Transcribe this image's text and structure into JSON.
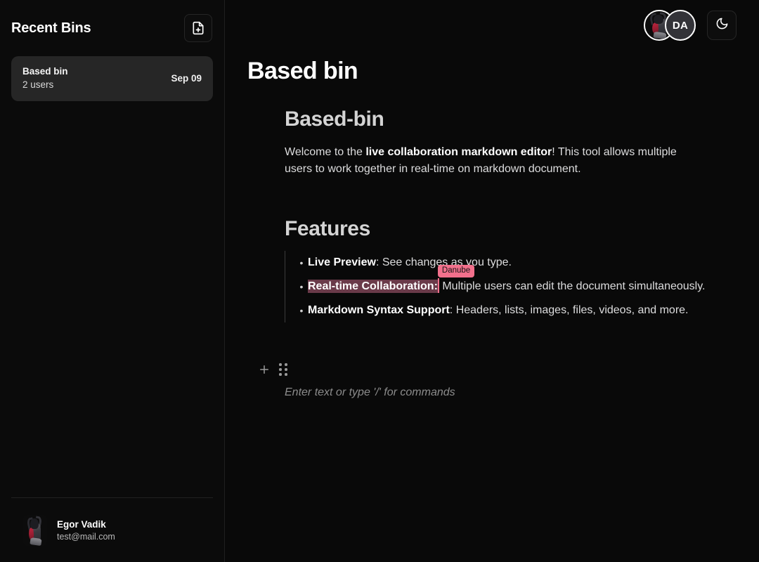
{
  "sidebar": {
    "title": "Recent Bins",
    "new_bin_icon": "file-plus-icon",
    "bins": [
      {
        "name": "Based bin",
        "users": "2 users",
        "date": "Sep 09"
      }
    ],
    "account": {
      "name": "Egor Vadik",
      "email": "test@mail.com",
      "avatar": "user-avatar-image"
    }
  },
  "header": {
    "collaborators": [
      {
        "type": "image",
        "name": "collaborator-avatar-image"
      },
      {
        "type": "initials",
        "initials": "DA"
      }
    ],
    "theme_toggle_icon": "moon-icon"
  },
  "document": {
    "title": "Based bin",
    "heading": "Based-bin",
    "intro": {
      "part1": "Welcome to the ",
      "bold": "live collaboration markdown editor",
      "part2": "! This tool allows multiple users to work together in real-time on markdown document."
    },
    "features_heading": "Features",
    "features": [
      {
        "bold": "Live Preview",
        "rest": ": See changes as you type.",
        "selected": false
      },
      {
        "bold": "Real-time Collaboration:",
        "rest": " Multiple users can edit the document simultaneously.",
        "selected": true,
        "remote_user": "Danube"
      },
      {
        "bold": "Markdown Syntax Support",
        "rest": ": Headers, lists, images, files, videos, and more.",
        "selected": false
      }
    ],
    "placeholder": "Enter text or type '/' for commands",
    "tools": {
      "add_icon": "plus-icon",
      "drag_icon": "drag-handle-icon"
    }
  },
  "colors": {
    "background": "#090909",
    "sidebar_background": "#0b0b0b",
    "active_item": "#262626",
    "remote_accent": "#f2708c",
    "selection": "#6a3a49"
  }
}
